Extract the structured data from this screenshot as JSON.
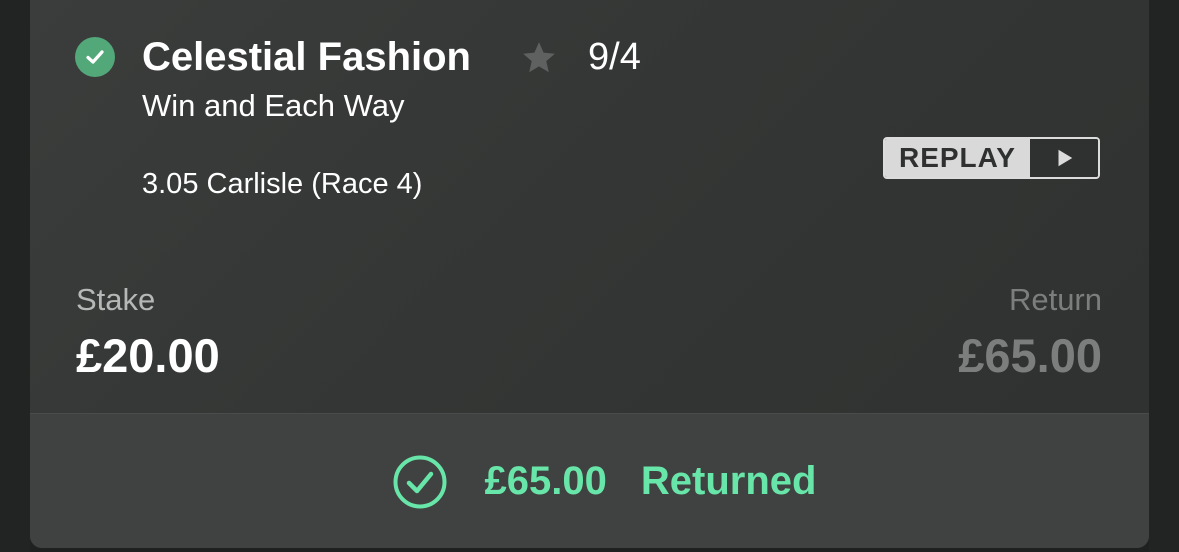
{
  "selection": {
    "name": "Celestial Fashion",
    "odds": "9/4",
    "market": "Win and Each Way",
    "event": "3.05 Carlisle (Race 4)",
    "status_icon": "check-circle-icon",
    "favourite_icon": "star-icon"
  },
  "replay": {
    "label": "REPLAY",
    "icon": "play-icon"
  },
  "stake": {
    "label": "Stake",
    "value": "£20.00"
  },
  "return": {
    "label": "Return",
    "value": "£65.00"
  },
  "result": {
    "amount": "£65.00",
    "text": "Returned",
    "icon": "check-circle-outline-icon"
  },
  "colors": {
    "win_green": "#53a87a",
    "returned_green": "#68e5a8",
    "card_bg": "#363837",
    "footer_bg": "#404241"
  }
}
